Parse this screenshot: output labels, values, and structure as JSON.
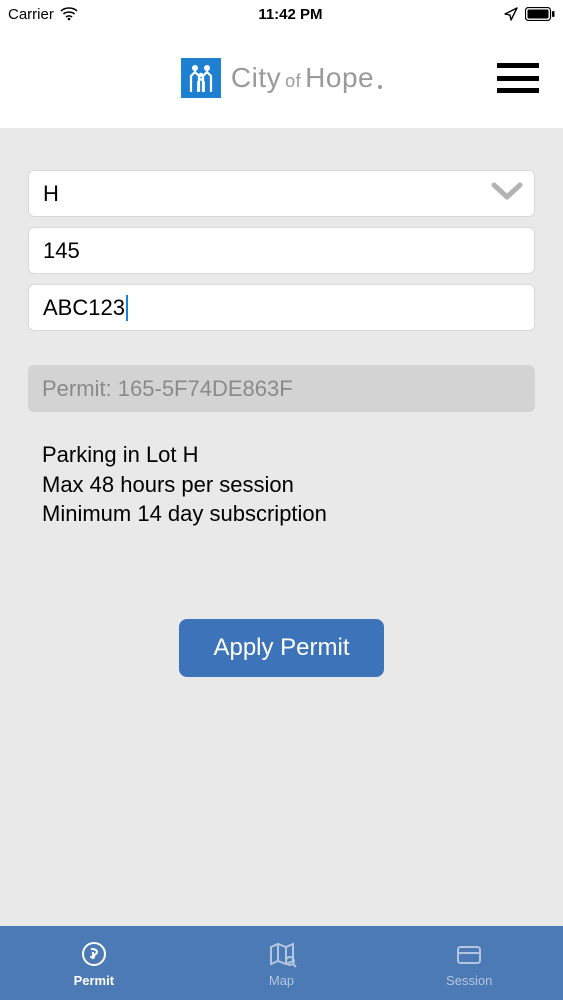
{
  "status_bar": {
    "carrier": "Carrier",
    "time": "11:42 PM"
  },
  "header": {
    "logo_city": "City",
    "logo_of": "of",
    "logo_hope": "Hope"
  },
  "form": {
    "lot_value": "H",
    "space_value": "145",
    "plate_value": "ABC123"
  },
  "permit": {
    "label": "Permit: 165-5F74DE863F"
  },
  "info": {
    "line1": "Parking in Lot H",
    "line2": "Max 48 hours per session",
    "line3": "Minimum 14 day subscription"
  },
  "buttons": {
    "apply": "Apply Permit"
  },
  "tabs": {
    "permit": "Permit",
    "map": "Map",
    "session": "Session"
  }
}
